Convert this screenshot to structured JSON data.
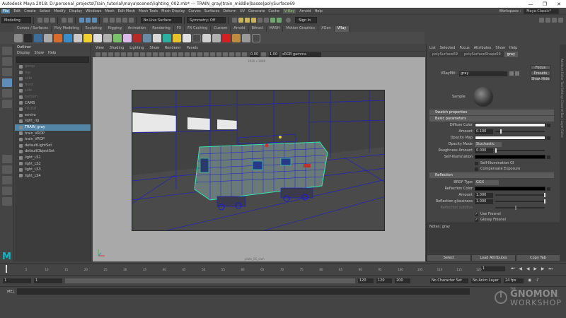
{
  "title_bar": {
    "title": "Autodesk Maya 2018: D:\\personal_projects\\Train_tutorial\\maya\\scenes\\lighting_002.mb*   ---   TRAIN_gray|train_middle|basse|polySurface69",
    "minimize": "—",
    "maximize": "❐",
    "close": "✕"
  },
  "menu_bar": {
    "items": [
      "File",
      "Edit",
      "Create",
      "Select",
      "Modify",
      "Display",
      "Windows",
      "Mesh",
      "Edit Mesh",
      "Mesh Tools",
      "Mesh Display",
      "Curves",
      "Surfaces",
      "Deform",
      "UV",
      "Generate",
      "Cache",
      "V-Ray",
      "Arnold",
      "Help"
    ],
    "workspace_label": "Workspace :",
    "workspace_value": "Maya Classic*"
  },
  "status_line": {
    "mode": "Modeling",
    "live_surface": "No Live Surface",
    "symmetry": "Symmetry: Off",
    "sign_in": "Sign In"
  },
  "shelf": {
    "tabs": [
      "Curves / Surfaces",
      "Poly Modeling",
      "Sculpting",
      "Rigging",
      "Animation",
      "Rendering",
      "FX",
      "FX Caching",
      "Custom",
      "Arnold",
      "Bifrost",
      "MASH",
      "Motion Graphics",
      "XGen",
      "VRay"
    ],
    "active_tab": "VRay"
  },
  "outliner": {
    "title": "Outliner",
    "menus": [
      "Display",
      "Show",
      "Help"
    ],
    "items": [
      {
        "label": "persp",
        "dim": true
      },
      {
        "label": "top",
        "dim": true
      },
      {
        "label": "side",
        "dim": true
      },
      {
        "label": "front",
        "dim": true
      },
      {
        "label": "side",
        "dim": true
      },
      {
        "label": "bottom",
        "dim": true
      },
      {
        "label": "CAMS",
        "dim": false
      },
      {
        "label": "FRONT",
        "dim": true
      },
      {
        "label": "enviro",
        "dim": false
      },
      {
        "label": "light_rig",
        "dim": false
      },
      {
        "label": "TRAIN_gray",
        "dim": false,
        "selected": true
      },
      {
        "label": "train_VROP",
        "dim": false
      },
      {
        "label": "train_VROP",
        "dim": false
      },
      {
        "label": "defaultLightSet",
        "dim": false
      },
      {
        "label": "defaultObjectSet",
        "dim": false
      },
      {
        "label": "light_LS1",
        "dim": false
      },
      {
        "label": "light_LS2",
        "dim": false
      },
      {
        "label": "light_LS3",
        "dim": false
      },
      {
        "label": "light_LS4",
        "dim": false
      }
    ]
  },
  "viewport": {
    "menus": [
      "View",
      "Shading",
      "Lighting",
      "Show",
      "Renderer",
      "Panels"
    ],
    "exposure": "0.00",
    "gamma": "1.00",
    "color_space": "sRGB gamma",
    "resolution": "1920 x 1080",
    "camera_label": "plate_01_cam"
  },
  "attribute_editor": {
    "menus": [
      "List",
      "Selected",
      "Focus",
      "Attributes",
      "Show",
      "Help"
    ],
    "tabs": [
      "polySurface69",
      "polySurfaceShape69",
      "gray"
    ],
    "active_tab": "gray",
    "node_type_label": "VRayMtl:",
    "node_name": "gray",
    "buttons": {
      "focus": "Focus",
      "presets": "Presets",
      "show": "Show",
      "hide": "Hide"
    },
    "sample_label": "Sample",
    "sections": {
      "swatch": "Swatch properties",
      "basic": "Basic parameters",
      "reflection": "Reflection"
    },
    "basic": {
      "diffuse_color": "Diffuse Color",
      "amount_label": "Amount",
      "amount_value": "0.100",
      "opacity_map": "Opacity Map",
      "opacity_mode_label": "Opacity Mode",
      "opacity_mode_value": "Stochastic",
      "roughness_label": "Roughness Amount",
      "roughness_value": "0.000",
      "self_illum": "Self-Illumination",
      "self_illum_gi": "Self-Illumination GI",
      "comp_exposure": "Compensate Exposure"
    },
    "reflection": {
      "brdf_label": "BRDF Type",
      "brdf_value": "GGX",
      "refl_color": "Reflection Color",
      "amount_label": "Amount",
      "amount_value": "1.000",
      "gloss_label": "Reflection glossiness",
      "gloss_value": "1.000",
      "subdivs_label": "Reflection subdivs",
      "use_fresnel": "Use Fresnel",
      "glossy_fresnel": "Glossy Fresnel"
    },
    "notes": "Notes:  gray",
    "bottom_buttons": [
      "Select",
      "Load Attributes",
      "Copy Tab"
    ],
    "side_tabs": "Attribute Editor   Tool Settings   Channel Box / Layer Editor"
  },
  "timeline": {
    "ticks": [
      "1",
      "5",
      "10",
      "15",
      "20",
      "25",
      "30",
      "35",
      "40",
      "45",
      "50",
      "55",
      "60",
      "65",
      "70",
      "75",
      "80",
      "85",
      "90",
      "95",
      "100",
      "105",
      "110",
      "115",
      "120"
    ],
    "current_frame": "1"
  },
  "range_slider": {
    "start": "1",
    "inner_start": "1",
    "inner_end": "120",
    "end": "120",
    "end2": "200",
    "character_set": "No Character Set",
    "anim_layer": "No Anim Layer",
    "fps": "24 fps"
  },
  "command_line": {
    "label": "MEL"
  },
  "watermark": {
    "line1": "THE",
    "line2": "GNOMON",
    "line3": "WORKSHOP"
  },
  "colors": {
    "maya_accent": "#5285a6",
    "wireframe": "#1a1ad6",
    "selection": "#35e6b0"
  }
}
